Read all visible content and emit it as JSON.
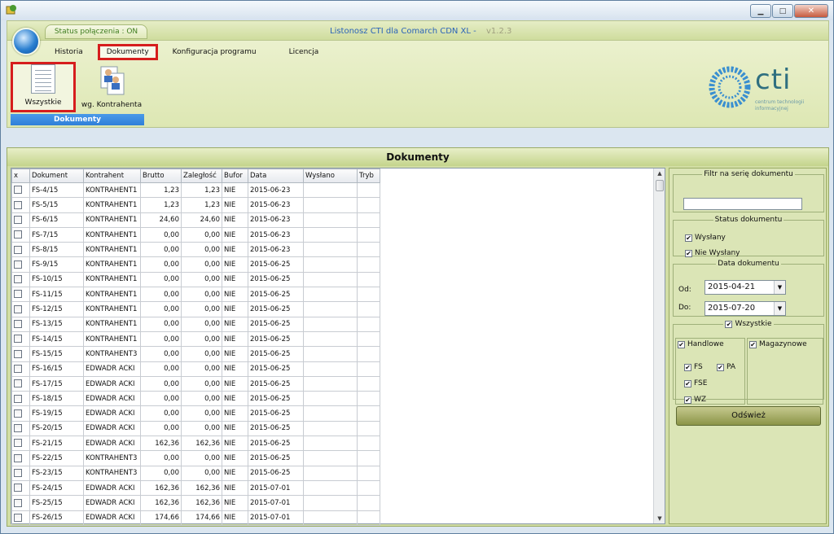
{
  "window": {
    "status": "Status połączenia : ON",
    "title": "Listonosz CTI dla Comarch CDN XL -",
    "version": "v1.2.3",
    "minimize": "▁",
    "maximize": "□",
    "close": "✕"
  },
  "menu": {
    "items": [
      {
        "label": "Historia"
      },
      {
        "label": "Dokumenty",
        "active": true
      },
      {
        "label": "Konfiguracja programu"
      },
      {
        "label": "Licencja"
      }
    ]
  },
  "ribbon": {
    "group_label": "Dokumenty",
    "buttons": [
      {
        "label": "Wszystkie",
        "icon": "documents-list-icon",
        "selected": true
      },
      {
        "label": "wg. Kontrahenta",
        "icon": "contractor-documents-icon"
      }
    ]
  },
  "logo": {
    "text": "cti",
    "sub1": "centrum technologii",
    "sub2": "informacyjnej"
  },
  "main": {
    "title": "Dokumenty"
  },
  "table": {
    "columns": [
      "x",
      "Dokument",
      "Kontrahent",
      "Brutto",
      "Zaległość",
      "Bufor",
      "Data",
      "Wysłano",
      "Tryb"
    ],
    "rows": [
      [
        "",
        "FS-4/15",
        "KONTRAHENT1",
        "1,23",
        "1,23",
        "NIE",
        "2015-06-23",
        "",
        ""
      ],
      [
        "",
        "FS-5/15",
        "KONTRAHENT1",
        "1,23",
        "1,23",
        "NIE",
        "2015-06-23",
        "",
        ""
      ],
      [
        "",
        "FS-6/15",
        "KONTRAHENT1",
        "24,60",
        "24,60",
        "NIE",
        "2015-06-23",
        "",
        ""
      ],
      [
        "",
        "FS-7/15",
        "KONTRAHENT1",
        "0,00",
        "0,00",
        "NIE",
        "2015-06-23",
        "",
        ""
      ],
      [
        "",
        "FS-8/15",
        "KONTRAHENT1",
        "0,00",
        "0,00",
        "NIE",
        "2015-06-23",
        "",
        ""
      ],
      [
        "",
        "FS-9/15",
        "KONTRAHENT1",
        "0,00",
        "0,00",
        "NIE",
        "2015-06-25",
        "",
        ""
      ],
      [
        "",
        "FS-10/15",
        "KONTRAHENT1",
        "0,00",
        "0,00",
        "NIE",
        "2015-06-25",
        "",
        ""
      ],
      [
        "",
        "FS-11/15",
        "KONTRAHENT1",
        "0,00",
        "0,00",
        "NIE",
        "2015-06-25",
        "",
        ""
      ],
      [
        "",
        "FS-12/15",
        "KONTRAHENT1",
        "0,00",
        "0,00",
        "NIE",
        "2015-06-25",
        "",
        ""
      ],
      [
        "",
        "FS-13/15",
        "KONTRAHENT1",
        "0,00",
        "0,00",
        "NIE",
        "2015-06-25",
        "",
        ""
      ],
      [
        "",
        "FS-14/15",
        "KONTRAHENT1",
        "0,00",
        "0,00",
        "NIE",
        "2015-06-25",
        "",
        ""
      ],
      [
        "",
        "FS-15/15",
        "KONTRAHENT3",
        "0,00",
        "0,00",
        "NIE",
        "2015-06-25",
        "",
        ""
      ],
      [
        "",
        "FS-16/15",
        "EDWADR ACKI",
        "0,00",
        "0,00",
        "NIE",
        "2015-06-25",
        "",
        ""
      ],
      [
        "",
        "FS-17/15",
        "EDWADR ACKI",
        "0,00",
        "0,00",
        "NIE",
        "2015-06-25",
        "",
        ""
      ],
      [
        "",
        "FS-18/15",
        "EDWADR ACKI",
        "0,00",
        "0,00",
        "NIE",
        "2015-06-25",
        "",
        ""
      ],
      [
        "",
        "FS-19/15",
        "EDWADR ACKI",
        "0,00",
        "0,00",
        "NIE",
        "2015-06-25",
        "",
        ""
      ],
      [
        "",
        "FS-20/15",
        "EDWADR ACKI",
        "0,00",
        "0,00",
        "NIE",
        "2015-06-25",
        "",
        ""
      ],
      [
        "",
        "FS-21/15",
        "EDWADR ACKI",
        "162,36",
        "162,36",
        "NIE",
        "2015-06-25",
        "",
        ""
      ],
      [
        "",
        "FS-22/15",
        "KONTRAHENT3",
        "0,00",
        "0,00",
        "NIE",
        "2015-06-25",
        "",
        ""
      ],
      [
        "",
        "FS-23/15",
        "KONTRAHENT3",
        "0,00",
        "0,00",
        "NIE",
        "2015-06-25",
        "",
        ""
      ],
      [
        "",
        "FS-24/15",
        "EDWADR ACKI",
        "162,36",
        "162,36",
        "NIE",
        "2015-07-01",
        "",
        ""
      ],
      [
        "",
        "FS-25/15",
        "EDWADR ACKI",
        "162,36",
        "162,36",
        "NIE",
        "2015-07-01",
        "",
        ""
      ],
      [
        "",
        "FS-26/15",
        "EDWADR ACKI",
        "174,66",
        "174,66",
        "NIE",
        "2015-07-01",
        "",
        ""
      ]
    ]
  },
  "filters": {
    "series_label": "Filtr na serię dokumentu",
    "series_value": "",
    "status_label": "Status dokumentu",
    "status_sent": "Wysłany",
    "status_not_sent": "Nie Wysłany",
    "date_label": "Data dokumentu",
    "from_label": "Od:",
    "from_value": "2015-04-21",
    "to_label": "Do:",
    "to_value": "2015-07-20",
    "all_label": "Wszystkie",
    "trade_label": "Handlowe",
    "warehouse_label": "Magazynowe",
    "fs": "FS",
    "pa": "PA",
    "fse": "FSE",
    "wz": "WZ",
    "check": "✔",
    "refresh": "Odśwież"
  }
}
